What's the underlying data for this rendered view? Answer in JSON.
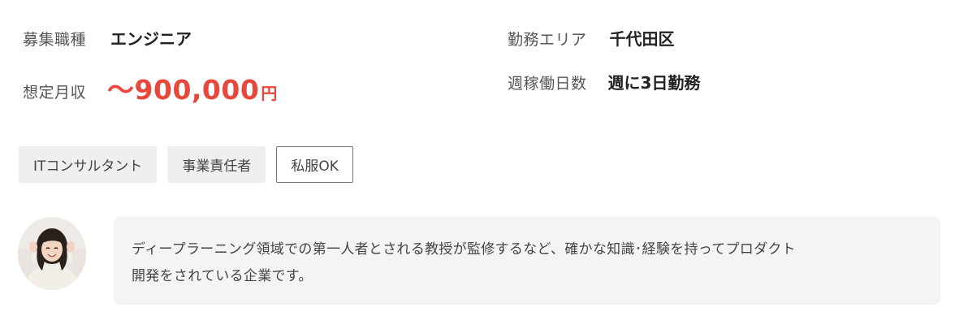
{
  "job_info": {
    "job_type": {
      "label": "募集職種",
      "value": "エンジニア"
    },
    "work_area": {
      "label": "勤務エリア",
      "value": "千代田区"
    },
    "salary": {
      "label": "想定月収",
      "amount": "〜900,000",
      "unit": "円"
    },
    "work_days": {
      "label": "週稼働日数",
      "value": "週に3日勤務"
    }
  },
  "tags": [
    {
      "label": "ITコンサルタント",
      "style": "filled"
    },
    {
      "label": "事業責任者",
      "style": "filled"
    },
    {
      "label": "私服OK",
      "style": "outlined"
    }
  ],
  "comment": {
    "line1": "ディープラーニング領域での第一人者とされる教授が監修するなど、確かな知識･経験を持ってプロダクト",
    "line2": "開発をされている企業です。"
  },
  "colors": {
    "salary": "#e8473b",
    "tag_background": "#efefef",
    "comment_background": "#f4f4f4"
  }
}
